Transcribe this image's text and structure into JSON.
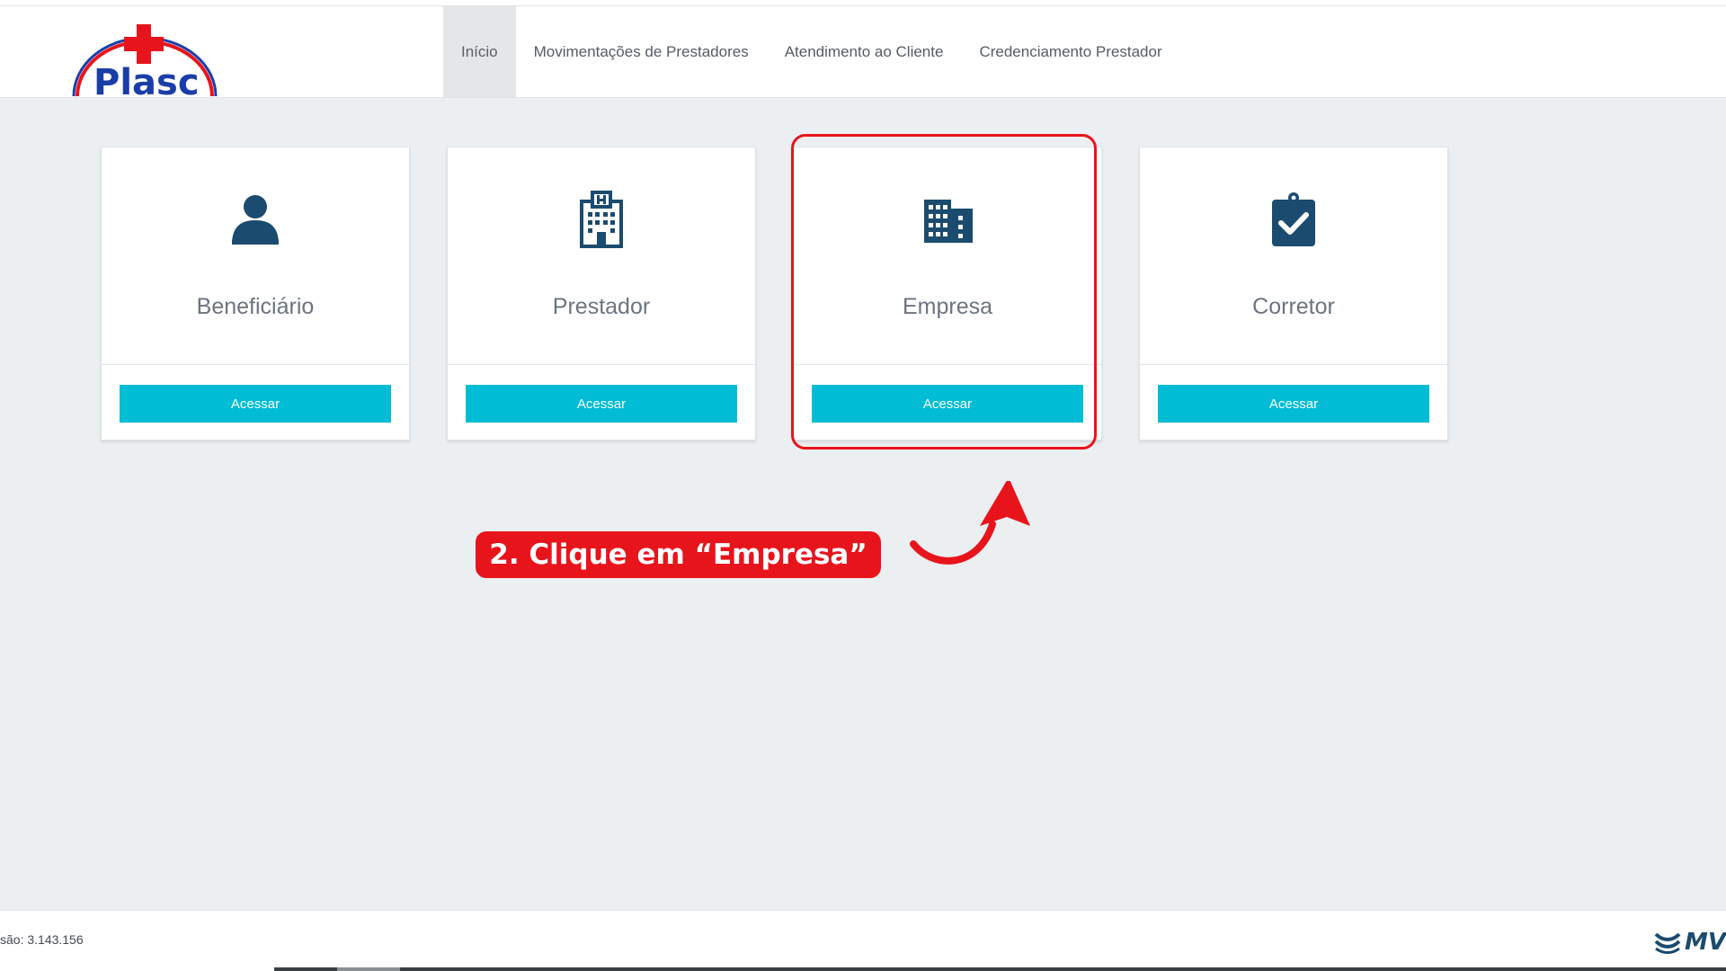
{
  "header": {
    "logo_text": "Plasc",
    "nav": [
      {
        "label": "Início",
        "active": true
      },
      {
        "label": "Movimentações de Prestadores",
        "active": false
      },
      {
        "label": "Atendimento ao Cliente",
        "active": false
      },
      {
        "label": "Credenciamento Prestador",
        "active": false
      }
    ]
  },
  "cards": [
    {
      "title": "Beneficiário",
      "icon": "user-icon",
      "button_label": "Acessar"
    },
    {
      "title": "Prestador",
      "icon": "hospital-icon",
      "button_label": "Acessar"
    },
    {
      "title": "Empresa",
      "icon": "building-icon",
      "button_label": "Acessar"
    },
    {
      "title": "Corretor",
      "icon": "clipboard-check-icon",
      "button_label": "Acessar"
    }
  ],
  "annotation": {
    "callout_text": "2. Clique em “Empresa”",
    "highlight_color": "#e8141c"
  },
  "footer": {
    "version_text": "são: 3.143.156",
    "brand_text": "MV"
  },
  "colors": {
    "accent": "#00bcd4",
    "icon": "#1b4b6e",
    "logo_red": "#e8141c",
    "logo_blue": "#1a3ea8"
  }
}
